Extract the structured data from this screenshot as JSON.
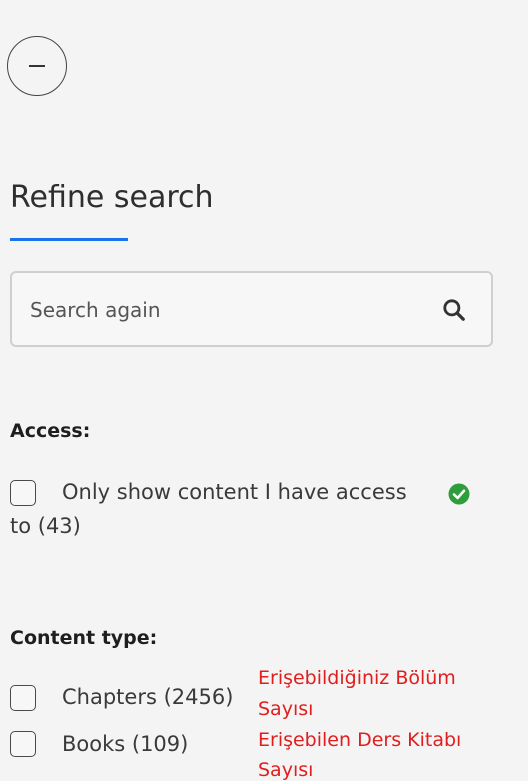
{
  "sidebar": {
    "collapse_icon": "minus-circle-icon",
    "title": "Refine search",
    "accent_color": "#1a73e8",
    "search": {
      "placeholder": "Search again",
      "icon": "search-icon"
    },
    "access": {
      "heading": "Access:",
      "option_line1": "Only show content I have access",
      "option_line2": "to (43)",
      "badge_icon": "check-circle-icon",
      "badge_color": "#2e9e3c",
      "checked": false
    },
    "content_type": {
      "heading": "Content type:",
      "options": [
        {
          "label": "Chapters (2456)",
          "checked": false
        },
        {
          "label": "Books (109)",
          "checked": false
        }
      ]
    }
  },
  "annotations": {
    "color": "#e01e1e",
    "chapters_note_line1": "Erişebildiğiniz Bölüm",
    "chapters_note_line2": "Sayısı",
    "books_note_line1": "Erişebilen Ders Kitabı",
    "books_note_line2": "Sayısı"
  }
}
